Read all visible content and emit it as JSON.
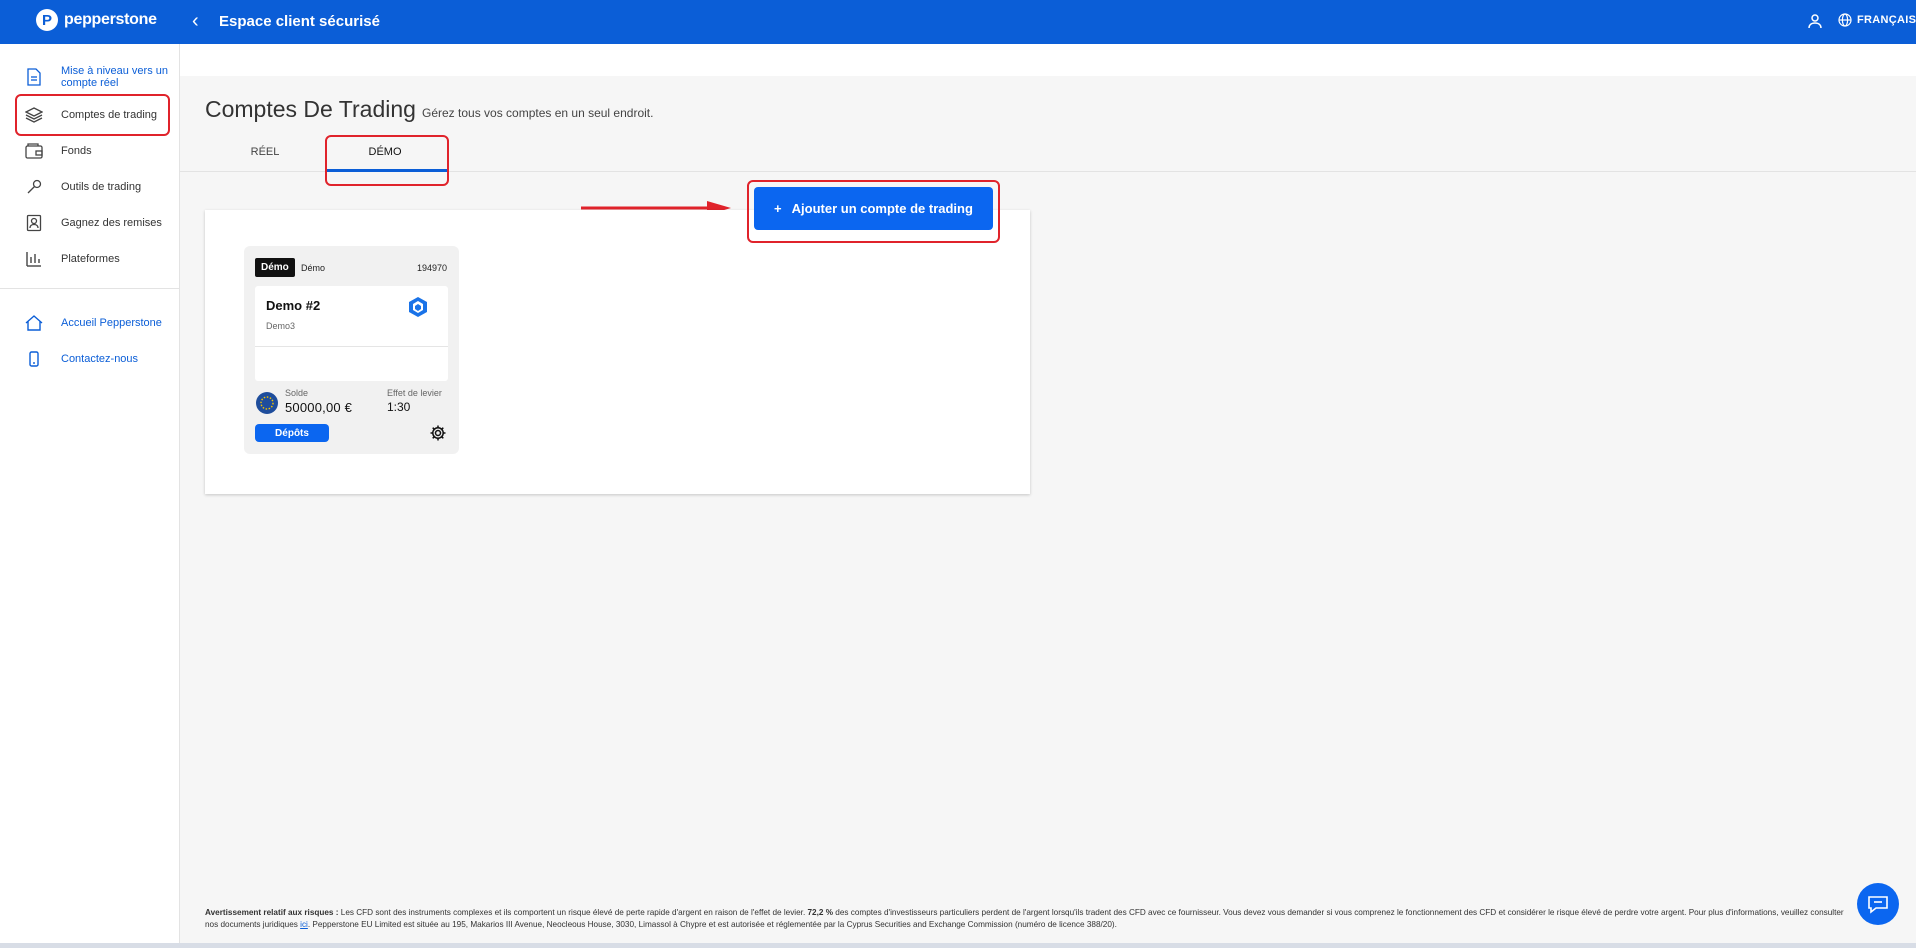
{
  "header": {
    "brand": "pepperstone",
    "title": "Espace client sécurisé",
    "language": "FRANÇAIS",
    "accent_color": "#0b5ed7"
  },
  "sidebar": {
    "items": [
      {
        "label": "Mise à niveau vers un compte réel",
        "icon": "document-icon"
      },
      {
        "label": "Comptes de trading",
        "icon": "layers-icon"
      },
      {
        "label": "Fonds",
        "icon": "wallet-icon"
      },
      {
        "label": "Outils de trading",
        "icon": "tool-icon"
      },
      {
        "label": "Gagnez des remises",
        "icon": "badge-icon"
      },
      {
        "label": "Plateformes",
        "icon": "bar-chart-icon"
      }
    ],
    "links": [
      {
        "label": "Accueil Pepperstone",
        "icon": "home-icon"
      },
      {
        "label": "Contactez-nous",
        "icon": "phone-icon"
      }
    ]
  },
  "main": {
    "title": "Comptes De Trading",
    "subtitle": "Gérez tous vos comptes en un seul endroit.",
    "tabs": [
      {
        "label": "RÉEL",
        "active": false
      },
      {
        "label": "DÉMO",
        "active": true
      }
    ],
    "add_button": {
      "label": "Ajouter un compte de trading",
      "icon": "+"
    }
  },
  "account_card": {
    "badge": "Démo",
    "type": "Démo",
    "number": "194970",
    "name": "Demo #2",
    "server": "Demo3",
    "balance_label": "Solde",
    "balance": "50000,00 €",
    "leverage_label": "Effet de levier",
    "leverage": "1:30",
    "deposit_label": "Dépôts"
  },
  "footer": {
    "warning_title": "Avertissement relatif aux risques :",
    "text_1": " Les CFD sont des instruments complexes et ils comportent un risque élevé de perte rapide d'argent en raison de l'effet de levier. ",
    "percent": "72,2 %",
    "text_2": " des comptes d'investisseurs particuliers perdent de l'argent lorsqu'ils tradent des CFD avec ce fournisseur. Vous devez vous demander si vous comprenez le fonctionnement des CFD et considérer le risque élevé de perdre votre argent. Pour plus d'informations, veuillez consulter nos documents juridiques ",
    "link": "ici",
    "text_3": ". Pepperstone EU Limited est située au 195, Makarios III Avenue, Neocleous House, 3030, Limassol à Chypre et est autorisée et réglementée par la Cyprus Securities and Exchange Commission (numéro de licence 388/20)."
  }
}
